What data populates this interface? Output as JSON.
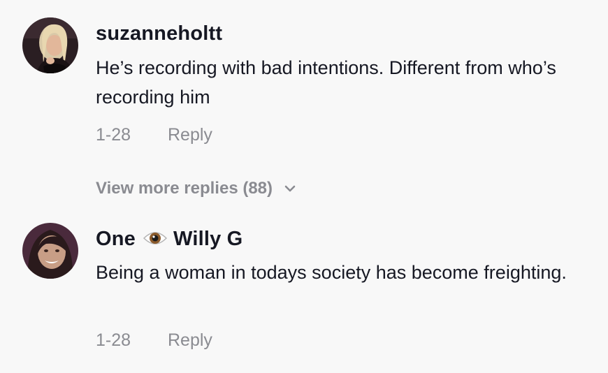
{
  "comments": [
    {
      "username": "suzanneholtt",
      "text": "He’s recording with bad intentions. Different from who’s recording him",
      "date": "1-28",
      "reply_label": "Reply",
      "avatar_icon": "user-avatar-photo"
    },
    {
      "username_part1": "One",
      "username_emoji": "eye-icon",
      "username_part2": "Willy G",
      "text": "Being a woman in todays society has become freighting.",
      "date": "1-28",
      "reply_label": "Reply",
      "avatar_icon": "user-avatar-photo"
    }
  ],
  "view_more": {
    "label": "View more replies (88)",
    "icon": "chevron-down-icon"
  },
  "colors": {
    "background": "#f8f8f8",
    "text": "#161823",
    "muted": "#8a8b91"
  }
}
